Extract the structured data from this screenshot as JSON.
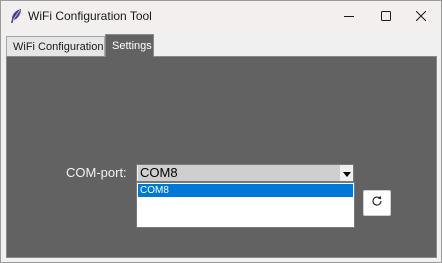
{
  "window": {
    "title": "WiFi Configuration Tool",
    "app_icon": "feather-icon",
    "controls": {
      "minimize_icon": "minimize-icon",
      "maximize_icon": "maximize-icon",
      "close_icon": "close-icon"
    }
  },
  "tabs": [
    {
      "label": "WiFi Configuration",
      "selected": false
    },
    {
      "label": "Settings",
      "selected": true
    }
  ],
  "settings": {
    "com_port_label": "COM-port:",
    "com_port_value": "COM8",
    "com_port_options": [
      "COM8"
    ],
    "highlighted_option": "COM8",
    "refresh_icon": "refresh-icon"
  },
  "colors": {
    "panel_background": "#626262",
    "selection_highlight": "#0078d7",
    "titlebar_background": "#f3efef"
  }
}
